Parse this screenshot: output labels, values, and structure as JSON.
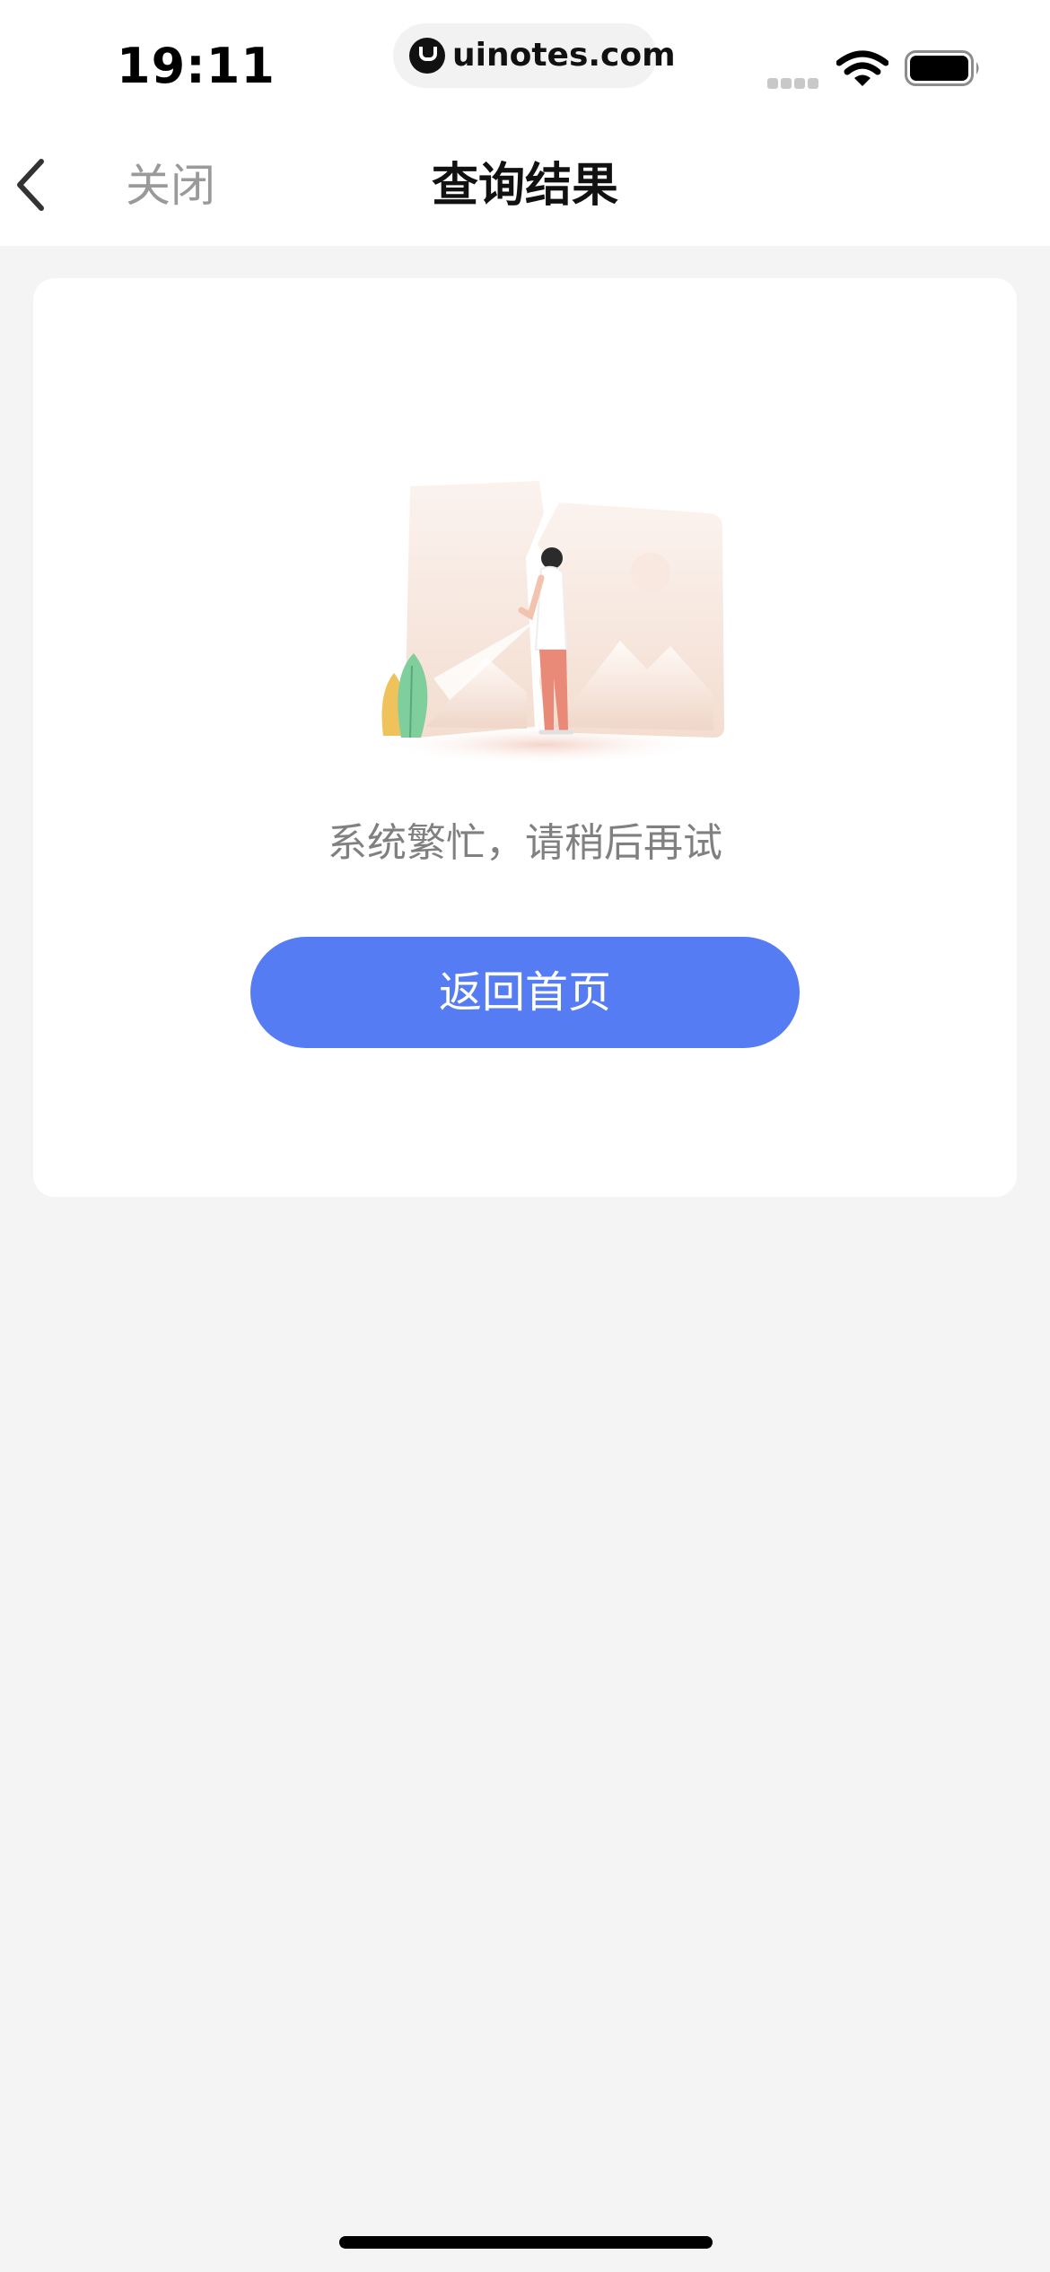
{
  "status_bar": {
    "time": "19:11",
    "url": "uinotes.com",
    "icons": [
      "site-logo-icon",
      "cellular-signal-icon",
      "wifi-icon",
      "battery-icon"
    ]
  },
  "nav": {
    "back_icon": "chevron-left-icon",
    "close_label": "关闭",
    "title": "查询结果"
  },
  "result": {
    "illustration": "broken-picture-illustration",
    "message": "系统繁忙，请稍后再试",
    "button_label": "返回首页"
  },
  "colors": {
    "accent": "#567cf3",
    "background": "#f4f4f4",
    "card": "#ffffff",
    "message_text": "#808080",
    "close_text": "#9a9a9a"
  }
}
